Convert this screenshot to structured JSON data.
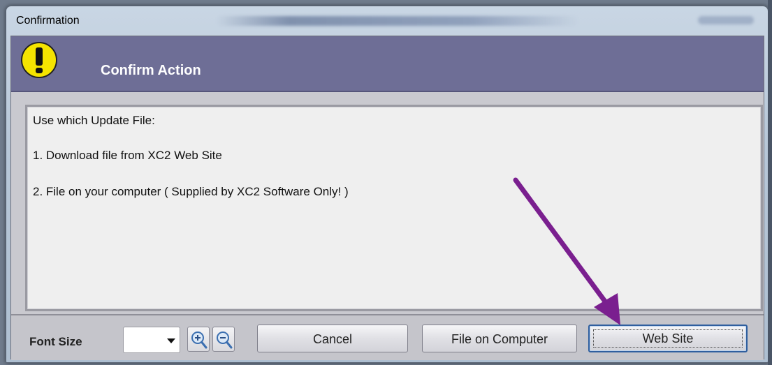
{
  "window": {
    "title": "Confirmation"
  },
  "header": {
    "icon": "warning-exclamation-icon",
    "title": "Confirm Action"
  },
  "message": {
    "lines": [
      "Use which Update File:",
      "1. Download file from XC2 Web Site",
      "2. File on your computer ( Supplied by XC2 Software Only! )"
    ]
  },
  "footer": {
    "font_size_label": "Font Size",
    "font_size_value": "",
    "zoom_in_icon": "zoom-in-icon",
    "zoom_out_icon": "zoom-out-icon",
    "buttons": {
      "cancel": "Cancel",
      "file_on_computer": "File on Computer",
      "web_site": "Web Site"
    }
  },
  "annotation": {
    "arrow_color": "#7a1f8f",
    "points_to": "web-site-button"
  },
  "colors": {
    "header_bg": "#6e6e96",
    "warning_yellow": "#f5e400",
    "message_bg": "#efefef",
    "default_button_border": "#2f5f9f"
  }
}
